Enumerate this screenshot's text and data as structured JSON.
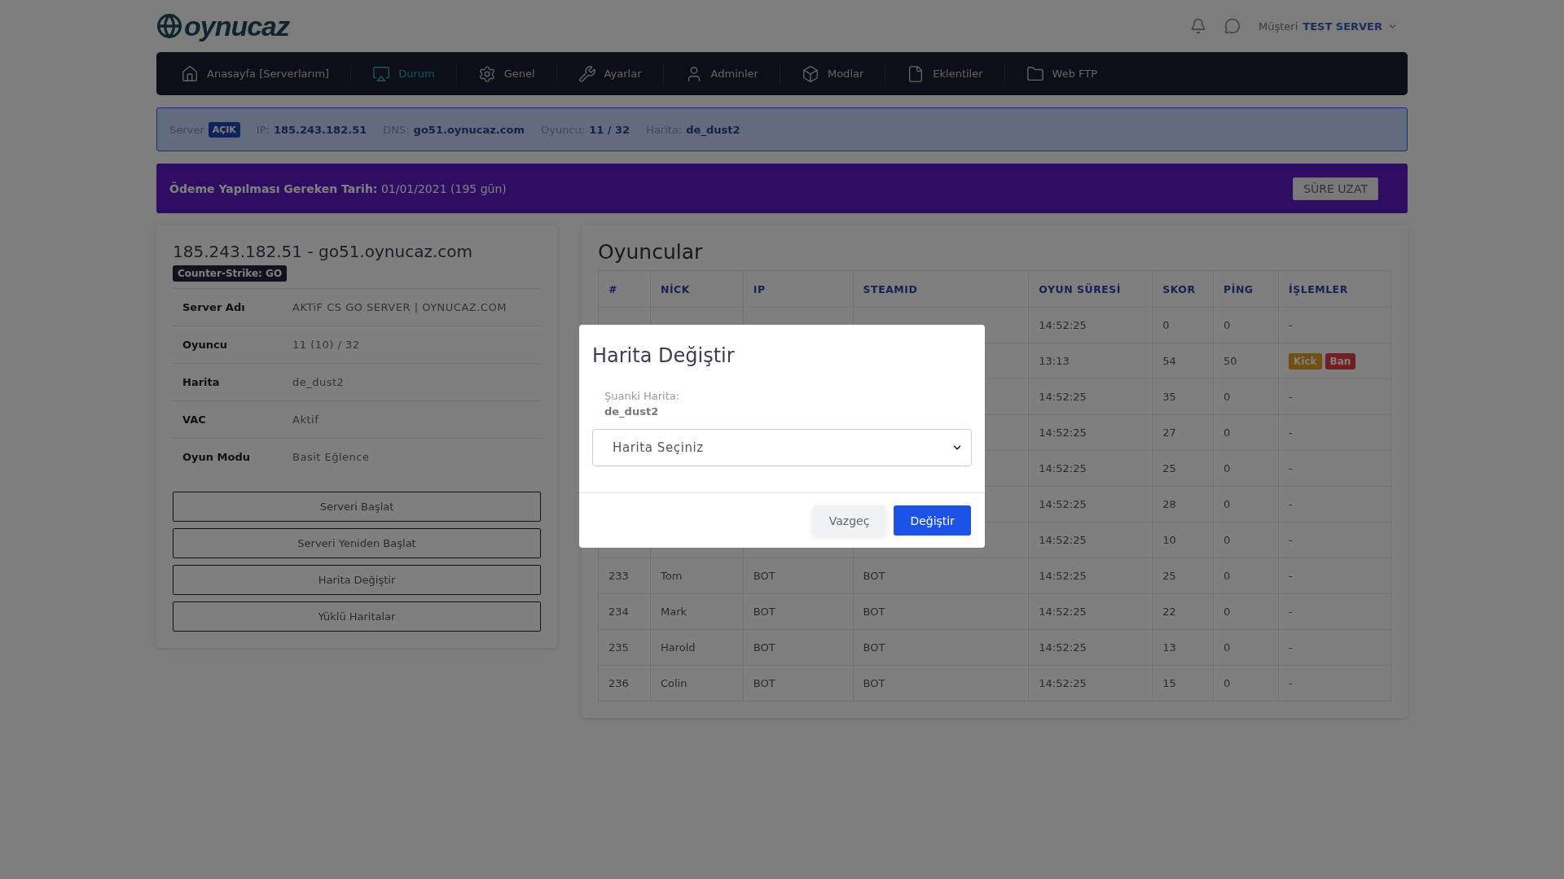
{
  "header": {
    "logo": "oynucaz",
    "account_label": "Müşteri",
    "account_name": "TEST SERVER"
  },
  "nav": [
    {
      "label": "Anasayfa [Serverlarım]",
      "selected": false
    },
    {
      "label": "Durum",
      "selected": true
    },
    {
      "label": "Genel",
      "selected": false
    },
    {
      "label": "Ayarlar",
      "selected": false
    },
    {
      "label": "Adminler",
      "selected": false
    },
    {
      "label": "Modlar",
      "selected": false
    },
    {
      "label": "Eklentiler",
      "selected": false
    },
    {
      "label": "Web FTP",
      "selected": false
    }
  ],
  "info_bar": {
    "server_label": "Server",
    "status_badge": "AÇIK",
    "items": [
      {
        "label": "IP:",
        "value": "185.243.182.51"
      },
      {
        "label": "DNS:",
        "value": "go51.oynucaz.com"
      },
      {
        "label": "Oyuncu:",
        "value": "11 / 32"
      },
      {
        "label": "Harita:",
        "value": "de_dust2"
      }
    ]
  },
  "payment_bar": {
    "text": "**Ödeme Yapılması Gereken Tarih:** 01/01/2021 (195 gün)",
    "button": "SÜRE UZAT"
  },
  "server_card": {
    "title": "185.243.182.51 - go51.oynucaz.com",
    "game_badge": "Counter-Strike: GO",
    "details": [
      {
        "label": "Server Adı",
        "value": "AKTiF CS GO SERVER | OYNUCAZ.COM"
      },
      {
        "label": "Oyuncu",
        "value": "11 (10) / 32"
      },
      {
        "label": "Harita",
        "value": "de_dust2"
      },
      {
        "label": "VAC",
        "value": "Aktif"
      },
      {
        "label": "Oyun Modu",
        "value": "Basit Eğlence"
      }
    ],
    "buttons": [
      "Serveri Başlat",
      "Serveri Yeniden Başlat",
      "Harita Değiştir",
      "Yüklü Haritalar"
    ]
  },
  "players": {
    "title": "Oyuncular",
    "columns": [
      "#",
      "NİCK",
      "IP",
      "STEAMID",
      "OYUN SÜRESİ",
      "SKOR",
      "PİNG",
      "İŞLEMLER"
    ],
    "rows": [
      {
        "time": "14:52:25",
        "score": "0",
        "ping": "0",
        "actions_text": "-"
      },
      {
        "time": "13:13",
        "score": "54",
        "ping": "50",
        "actions": [
          {
            "label": "Kick",
            "kind": "kick"
          },
          {
            "label": "Ban",
            "kind": "ban"
          }
        ]
      },
      {
        "time": "14:52:25",
        "score": "35",
        "ping": "0",
        "actions_text": "-"
      },
      {
        "time": "14:52:25",
        "score": "27",
        "ping": "0",
        "actions_text": "-"
      },
      {
        "time": "14:52:25",
        "score": "25",
        "ping": "0",
        "actions_text": "-"
      },
      {
        "time": "14:52:25",
        "score": "28",
        "ping": "0",
        "actions_text": "-"
      },
      {
        "time": "14:52:25",
        "score": "10",
        "ping": "0",
        "actions_text": "-"
      },
      {
        "id": "233",
        "nick": "Tom",
        "ip": "BOT",
        "steamid": "BOT",
        "time": "14:52:25",
        "score": "25",
        "ping": "0",
        "actions_text": "-"
      },
      {
        "id": "234",
        "nick": "Mark",
        "ip": "BOT",
        "steamid": "BOT",
        "time": "14:52:25",
        "score": "22",
        "ping": "0",
        "actions_text": "-"
      },
      {
        "id": "235",
        "nick": "Harold",
        "ip": "BOT",
        "steamid": "BOT",
        "time": "14:52:25",
        "score": "13",
        "ping": "0",
        "actions_text": "-"
      },
      {
        "id": "236",
        "nick": "Colin",
        "ip": "BOT",
        "steamid": "BOT",
        "time": "14:52:25",
        "score": "15",
        "ping": "0",
        "actions_text": "-"
      }
    ]
  },
  "modal": {
    "title": "Harita Değiştir",
    "current_label": "Şuanki Harita:",
    "current_value": "de_dust2",
    "select": {
      "placeholder": "Harita Seçiniz"
    },
    "buttons": [
      {
        "label": "Vazgeç",
        "kind": "secondary"
      },
      {
        "label": "Değiştir",
        "kind": "primary"
      }
    ]
  }
}
